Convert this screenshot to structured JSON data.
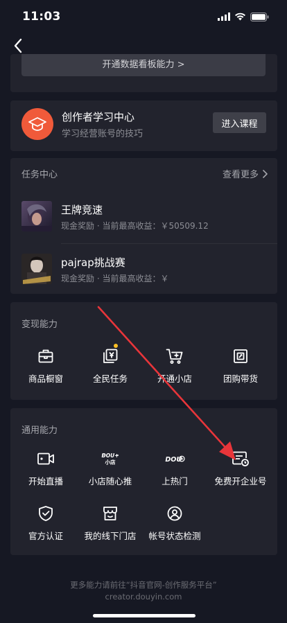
{
  "status": {
    "time": "11:03"
  },
  "top_strip": {
    "button_label": "开通数据看板能力 >"
  },
  "learning": {
    "title": "创作者学习中心",
    "subtitle": "学习经营账号的技巧",
    "button": "进入课程"
  },
  "tasks": {
    "title": "任务中心",
    "more": "查看更多",
    "items": [
      {
        "name": "王牌竞速",
        "desc": "现金奖励 · 当前最高收益：￥50509.12"
      },
      {
        "name": "pajrap挑战赛",
        "desc": "现金奖励 · 当前最高收益：￥"
      }
    ]
  },
  "monetize": {
    "title": "变现能力",
    "items": [
      {
        "label": "商品橱窗",
        "icon": "shopping-bag-icon"
      },
      {
        "label": "全民任务",
        "icon": "task-yuan-icon"
      },
      {
        "label": "开通小店",
        "icon": "cart-plus-icon"
      },
      {
        "label": "团购带货",
        "icon": "group-buy-icon"
      }
    ]
  },
  "general": {
    "title": "通用能力",
    "items": [
      {
        "label": "开始直播",
        "icon": "video-camera-icon"
      },
      {
        "label": "小店随心推",
        "icon": "dou-plus-shop-icon",
        "logo_text": "DOU+ 小店"
      },
      {
        "label": "上热门",
        "icon": "dou-plus-icon",
        "logo_text": "DOU+"
      },
      {
        "label": "免费开企业号",
        "icon": "enterprise-card-icon"
      },
      {
        "label": "官方认证",
        "icon": "shield-check-icon"
      },
      {
        "label": "我的线下门店",
        "icon": "store-icon"
      },
      {
        "label": "帐号状态检测",
        "icon": "account-check-icon"
      }
    ]
  },
  "footer": {
    "line1": "更多能力请前往“抖音官网-创作服务平台”",
    "line2": "creator.douyin.com"
  },
  "colors": {
    "background": "#161823",
    "card": "#22232d",
    "accent_orange": "#f05a3a",
    "annotation_arrow": "#e8353a",
    "badge_dot": "#fbbf24"
  }
}
